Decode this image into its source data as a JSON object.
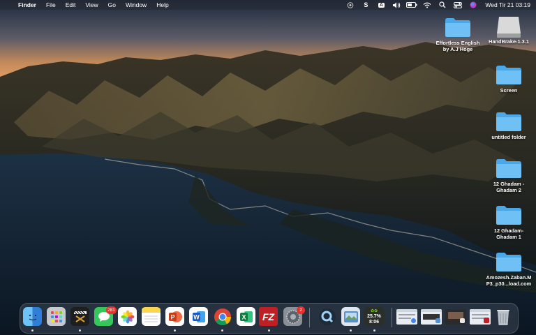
{
  "menubar": {
    "apple_glyph": "",
    "app_name": "Finder",
    "menus": [
      "File",
      "Edit",
      "View",
      "Go",
      "Window",
      "Help"
    ],
    "status_icons": [
      "screen-mirror-icon",
      "s-app-icon",
      "input-source-a-icon",
      "volume-icon",
      "battery-icon",
      "wifi-icon",
      "spotlight-search-icon",
      "control-center-icon",
      "siri-icon"
    ],
    "input_source": "A",
    "s_glyph": "S",
    "clock": "Wed Tir 21  03:19"
  },
  "desktop": {
    "icons": [
      {
        "label": "Effortless English\nby A.J Hoge",
        "kind": "folder"
      },
      {
        "label": "HandBrake-1.3.1",
        "kind": "disk"
      },
      {
        "label": "Screen",
        "kind": "folder"
      },
      {
        "label": "untitled folder",
        "kind": "folder"
      },
      {
        "label": "12 Ghadam -\nGhadam 2",
        "kind": "folder"
      },
      {
        "label": "12 Ghadam-\nGhadam 1",
        "kind": "folder"
      },
      {
        "label": "Amozesh.Zaban.M\nP3_p30...load.com",
        "kind": "folder"
      }
    ]
  },
  "dock": {
    "apps": [
      {
        "name": "finder-app-icon",
        "glyph": "☺",
        "bg": "#3a8ee6"
      },
      {
        "name": "launchpad-app-icon",
        "glyph": "",
        "bg": "#c7c9cf"
      },
      {
        "name": "final-cut-app-icon",
        "glyph": "✦",
        "bg": "#202020"
      },
      {
        "name": "messages-app-icon",
        "glyph": "●",
        "bg": "#35c759",
        "badge": "281"
      },
      {
        "name": "photos-app-icon",
        "glyph": "✿",
        "bg": "#ffffff"
      },
      {
        "name": "notes-app-icon",
        "glyph": "",
        "bg": "#fbe38a"
      },
      {
        "name": "powerpoint-app-icon",
        "glyph": "P",
        "bg": "#ffffff"
      },
      {
        "name": "word-app-icon",
        "glyph": "W",
        "bg": "#ffffff"
      },
      {
        "name": "chrome-app-icon",
        "glyph": "◉",
        "bg": "#ffffff"
      },
      {
        "name": "excel-app-icon",
        "glyph": "X",
        "bg": "#ffffff"
      },
      {
        "name": "filezilla-app-icon",
        "glyph": "FZ",
        "bg": "#bf2026"
      },
      {
        "name": "system-preferences-app-icon",
        "glyph": "⚙",
        "bg": "#8a8f98",
        "badge": "2"
      },
      {
        "name": "quicktime-app-icon",
        "glyph": "Q",
        "bg": "#2b3440"
      },
      {
        "name": "preview-app-icon",
        "glyph": "▣",
        "bg": "#6fa8dc"
      },
      {
        "name": "activity-monitor-app-icon",
        "glyph": "",
        "bg": "#2a2f2a",
        "cpu": "25.7%",
        "time": "8:06"
      }
    ],
    "minimized_windows": [
      "window-thumbnail-1",
      "window-thumbnail-2",
      "window-thumbnail-3",
      "window-thumbnail-4"
    ],
    "trash": "trash-icon"
  }
}
